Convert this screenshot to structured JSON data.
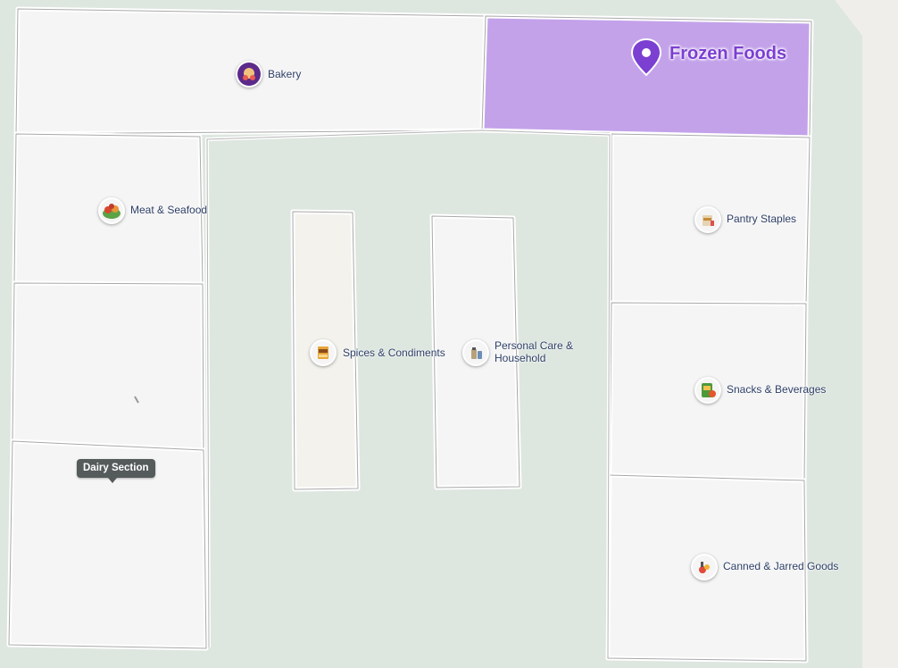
{
  "map": {
    "selected": {
      "label": "Frozen Foods",
      "pin_icon": "map-pin-icon",
      "color": "#c3a2ea",
      "accent": "#7b3fd1"
    },
    "tooltip": {
      "label": "Dairy Section"
    },
    "sections": [
      {
        "id": "bakery",
        "label": "Bakery",
        "icon": "bakery-icon"
      },
      {
        "id": "meat",
        "label": "Meat & Seafood",
        "icon": "meat-seafood-icon"
      },
      {
        "id": "spices",
        "label": "Spices & Condiments",
        "icon": "spices-condiments-icon"
      },
      {
        "id": "personal",
        "label_line1": "Personal Care &",
        "label_line2": "Household",
        "icon": "personal-care-icon"
      },
      {
        "id": "pantry",
        "label": "Pantry Staples",
        "icon": "pantry-staples-icon"
      },
      {
        "id": "snacks",
        "label": "Snacks & Beverages",
        "icon": "snacks-beverages-icon"
      },
      {
        "id": "canned",
        "label": "Canned & Jarred Goods",
        "icon": "canned-jarred-icon"
      }
    ],
    "colors": {
      "floor": "#dde6df",
      "room": "#f5f5f5",
      "wall": "#ffffff",
      "wall_edge": "#a9a9a9",
      "spices_room": "#f3f2ed",
      "outside": "#efeeeb"
    }
  }
}
